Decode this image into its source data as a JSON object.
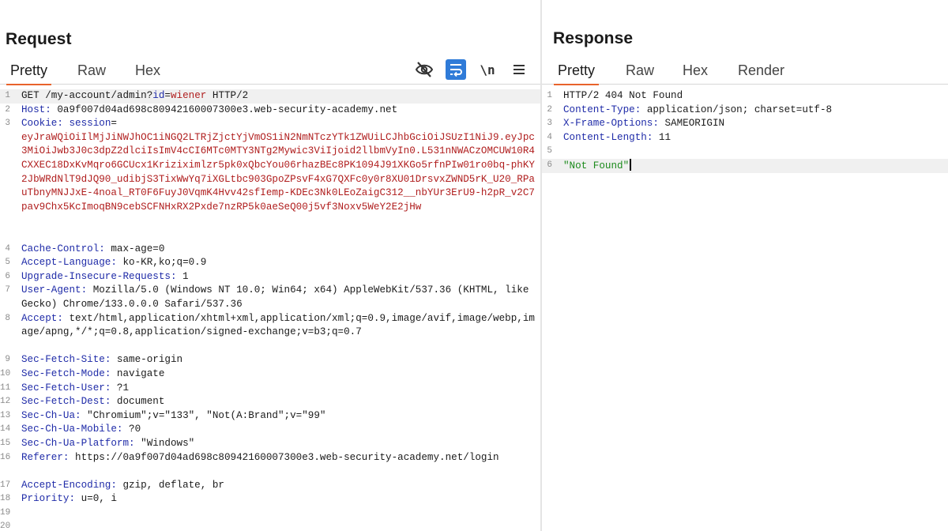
{
  "request": {
    "title": "Request",
    "tabs": [
      "Pretty",
      "Raw",
      "Hex"
    ],
    "active_tab": "Pretty",
    "toolbar": {
      "hide_icon": "eye-slash-icon",
      "wrap_icon": "word-wrap-icon",
      "newline_label": "\\n",
      "menu_icon": "hamburger-menu-icon"
    },
    "lines": [
      {
        "n": "1",
        "method": "GET",
        "path": " /my-account/admin?",
        "qk": "id",
        "eq": "=",
        "qv": "wiener",
        "proto": " HTTP/2"
      },
      {
        "n": "2",
        "key": "Host",
        "value": " 0a9f007d04ad698c80942160007300e3.web-security-academy.net"
      },
      {
        "n": "3",
        "key": "Cookie",
        "value": " ",
        "ck": "session",
        "ceq": "=",
        "cookie": "eyJraWQiOiIlMjJiNWJhOC1iNGQ2LTRjZjctYjVmOS1iN2NmNTczYTk1ZWUiLCJhbGciOiJSUzI1NiJ9.eyJpc3MiOiJwb3J0c3dpZ2dlciIsImV4cCI6MTc0MTY3NTg2Mywic3ViIjoid2llbmVyIn0.L531nNWACzOMCUW10R4CXXEC18DxKvMqro6GCUcx1Kriziximlzr5pk0xQbcYou06rhazBEc8PK1094J91XKGo5rfnPIw01ro0bq-phKY2JbWRdNlT9dJQ90_udibjS3TixWwYq7iXGLtbc903GpoZPsvF4xG7QXFc0y0r8XU01DrsvxZWND5rK_U20_RPauTbnyMNJJxE-4noal_RT0F6FuyJ0VqmK4Hvv42sfIemp-KDEc3Nk0LEoZaigC312__nbYUr3ErU9-h2pR_v2C7pav9Chx5KcImoqBN9cebSCFNHxRX2Pxde7nzRP5k0aeSeQ00j5vf3Noxv5WeY2E2jHw"
      },
      {
        "n": "4",
        "key": "Cache-Control",
        "value": " max-age=0"
      },
      {
        "n": "5",
        "key": "Accept-Language",
        "value": " ko-KR,ko;q=0.9"
      },
      {
        "n": "6",
        "key": "Upgrade-Insecure-Requests",
        "value": " 1"
      },
      {
        "n": "7",
        "key": "User-Agent",
        "value": " Mozilla/5.0 (Windows NT 10.0; Win64; x64) AppleWebKit/537.36 (KHTML, like Gecko) Chrome/133.0.0.0 Safari/537.36"
      },
      {
        "n": "8",
        "key": "Accept",
        "value": " text/html,application/xhtml+xml,application/xml;q=0.9,image/avif,image/webp,image/apng,*/*;q=0.8,application/signed-exchange;v=b3;q=0.7"
      },
      {
        "n": "9",
        "key": "Sec-Fetch-Site",
        "value": " same-origin"
      },
      {
        "n": "10",
        "key": "Sec-Fetch-Mode",
        "value": " navigate"
      },
      {
        "n": "11",
        "key": "Sec-Fetch-User",
        "value": " ?1"
      },
      {
        "n": "12",
        "key": "Sec-Fetch-Dest",
        "value": " document"
      },
      {
        "n": "13",
        "key": "Sec-Ch-Ua",
        "value": " \"Chromium\";v=\"133\", \"Not(A:Brand\";v=\"99\""
      },
      {
        "n": "14",
        "key": "Sec-Ch-Ua-Mobile",
        "value": " ?0"
      },
      {
        "n": "15",
        "key": "Sec-Ch-Ua-Platform",
        "value": " \"Windows\""
      },
      {
        "n": "16",
        "key": "Referer",
        "value": " https://0a9f007d04ad698c80942160007300e3.web-security-academy.net/login"
      },
      {
        "n": "17",
        "key": "Accept-Encoding",
        "value": " gzip, deflate, br"
      },
      {
        "n": "18",
        "key": "Priority",
        "value": " u=0, i"
      },
      {
        "n": "19"
      },
      {
        "n": "20"
      }
    ]
  },
  "response": {
    "title": "Response",
    "tabs": [
      "Pretty",
      "Raw",
      "Hex",
      "Render"
    ],
    "active_tab": "Pretty",
    "lines": [
      {
        "n": "1",
        "plain": "HTTP/2 404 Not Found"
      },
      {
        "n": "2",
        "key": "Content-Type",
        "value": " application/json; charset=utf-8"
      },
      {
        "n": "3",
        "key": "X-Frame-Options",
        "value": " SAMEORIGIN"
      },
      {
        "n": "4",
        "key": "Content-Length",
        "value": " 11"
      },
      {
        "n": "5"
      },
      {
        "n": "6",
        "string": "\"Not Found\""
      }
    ]
  },
  "colors": {
    "accent_tab_underline": "#e8632b",
    "header_key": "#1f2ba8",
    "cookie_value": "#b01e1e",
    "json_string": "#1b8a1b",
    "wrap_button_bg": "#2f7bd8"
  }
}
